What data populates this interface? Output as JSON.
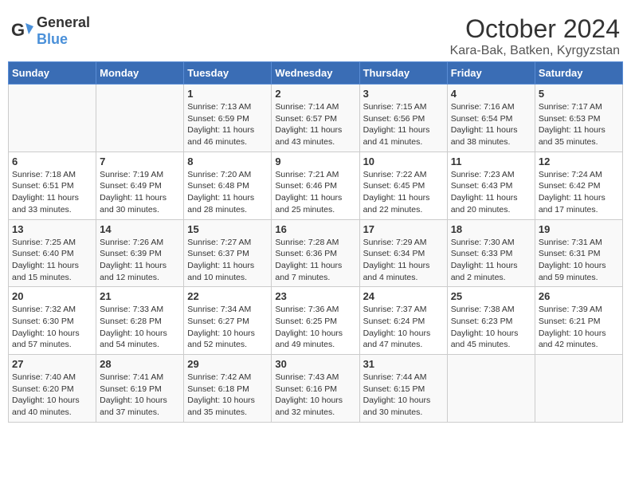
{
  "header": {
    "logo_general": "General",
    "logo_blue": "Blue",
    "month": "October 2024",
    "location": "Kara-Bak, Batken, Kyrgyzstan"
  },
  "weekdays": [
    "Sunday",
    "Monday",
    "Tuesday",
    "Wednesday",
    "Thursday",
    "Friday",
    "Saturday"
  ],
  "weeks": [
    [
      {
        "day": "",
        "info": ""
      },
      {
        "day": "",
        "info": ""
      },
      {
        "day": "1",
        "info": "Sunrise: 7:13 AM\nSunset: 6:59 PM\nDaylight: 11 hours and 46 minutes."
      },
      {
        "day": "2",
        "info": "Sunrise: 7:14 AM\nSunset: 6:57 PM\nDaylight: 11 hours and 43 minutes."
      },
      {
        "day": "3",
        "info": "Sunrise: 7:15 AM\nSunset: 6:56 PM\nDaylight: 11 hours and 41 minutes."
      },
      {
        "day": "4",
        "info": "Sunrise: 7:16 AM\nSunset: 6:54 PM\nDaylight: 11 hours and 38 minutes."
      },
      {
        "day": "5",
        "info": "Sunrise: 7:17 AM\nSunset: 6:53 PM\nDaylight: 11 hours and 35 minutes."
      }
    ],
    [
      {
        "day": "6",
        "info": "Sunrise: 7:18 AM\nSunset: 6:51 PM\nDaylight: 11 hours and 33 minutes."
      },
      {
        "day": "7",
        "info": "Sunrise: 7:19 AM\nSunset: 6:49 PM\nDaylight: 11 hours and 30 minutes."
      },
      {
        "day": "8",
        "info": "Sunrise: 7:20 AM\nSunset: 6:48 PM\nDaylight: 11 hours and 28 minutes."
      },
      {
        "day": "9",
        "info": "Sunrise: 7:21 AM\nSunset: 6:46 PM\nDaylight: 11 hours and 25 minutes."
      },
      {
        "day": "10",
        "info": "Sunrise: 7:22 AM\nSunset: 6:45 PM\nDaylight: 11 hours and 22 minutes."
      },
      {
        "day": "11",
        "info": "Sunrise: 7:23 AM\nSunset: 6:43 PM\nDaylight: 11 hours and 20 minutes."
      },
      {
        "day": "12",
        "info": "Sunrise: 7:24 AM\nSunset: 6:42 PM\nDaylight: 11 hours and 17 minutes."
      }
    ],
    [
      {
        "day": "13",
        "info": "Sunrise: 7:25 AM\nSunset: 6:40 PM\nDaylight: 11 hours and 15 minutes."
      },
      {
        "day": "14",
        "info": "Sunrise: 7:26 AM\nSunset: 6:39 PM\nDaylight: 11 hours and 12 minutes."
      },
      {
        "day": "15",
        "info": "Sunrise: 7:27 AM\nSunset: 6:37 PM\nDaylight: 11 hours and 10 minutes."
      },
      {
        "day": "16",
        "info": "Sunrise: 7:28 AM\nSunset: 6:36 PM\nDaylight: 11 hours and 7 minutes."
      },
      {
        "day": "17",
        "info": "Sunrise: 7:29 AM\nSunset: 6:34 PM\nDaylight: 11 hours and 4 minutes."
      },
      {
        "day": "18",
        "info": "Sunrise: 7:30 AM\nSunset: 6:33 PM\nDaylight: 11 hours and 2 minutes."
      },
      {
        "day": "19",
        "info": "Sunrise: 7:31 AM\nSunset: 6:31 PM\nDaylight: 10 hours and 59 minutes."
      }
    ],
    [
      {
        "day": "20",
        "info": "Sunrise: 7:32 AM\nSunset: 6:30 PM\nDaylight: 10 hours and 57 minutes."
      },
      {
        "day": "21",
        "info": "Sunrise: 7:33 AM\nSunset: 6:28 PM\nDaylight: 10 hours and 54 minutes."
      },
      {
        "day": "22",
        "info": "Sunrise: 7:34 AM\nSunset: 6:27 PM\nDaylight: 10 hours and 52 minutes."
      },
      {
        "day": "23",
        "info": "Sunrise: 7:36 AM\nSunset: 6:25 PM\nDaylight: 10 hours and 49 minutes."
      },
      {
        "day": "24",
        "info": "Sunrise: 7:37 AM\nSunset: 6:24 PM\nDaylight: 10 hours and 47 minutes."
      },
      {
        "day": "25",
        "info": "Sunrise: 7:38 AM\nSunset: 6:23 PM\nDaylight: 10 hours and 45 minutes."
      },
      {
        "day": "26",
        "info": "Sunrise: 7:39 AM\nSunset: 6:21 PM\nDaylight: 10 hours and 42 minutes."
      }
    ],
    [
      {
        "day": "27",
        "info": "Sunrise: 7:40 AM\nSunset: 6:20 PM\nDaylight: 10 hours and 40 minutes."
      },
      {
        "day": "28",
        "info": "Sunrise: 7:41 AM\nSunset: 6:19 PM\nDaylight: 10 hours and 37 minutes."
      },
      {
        "day": "29",
        "info": "Sunrise: 7:42 AM\nSunset: 6:18 PM\nDaylight: 10 hours and 35 minutes."
      },
      {
        "day": "30",
        "info": "Sunrise: 7:43 AM\nSunset: 6:16 PM\nDaylight: 10 hours and 32 minutes."
      },
      {
        "day": "31",
        "info": "Sunrise: 7:44 AM\nSunset: 6:15 PM\nDaylight: 10 hours and 30 minutes."
      },
      {
        "day": "",
        "info": ""
      },
      {
        "day": "",
        "info": ""
      }
    ]
  ]
}
